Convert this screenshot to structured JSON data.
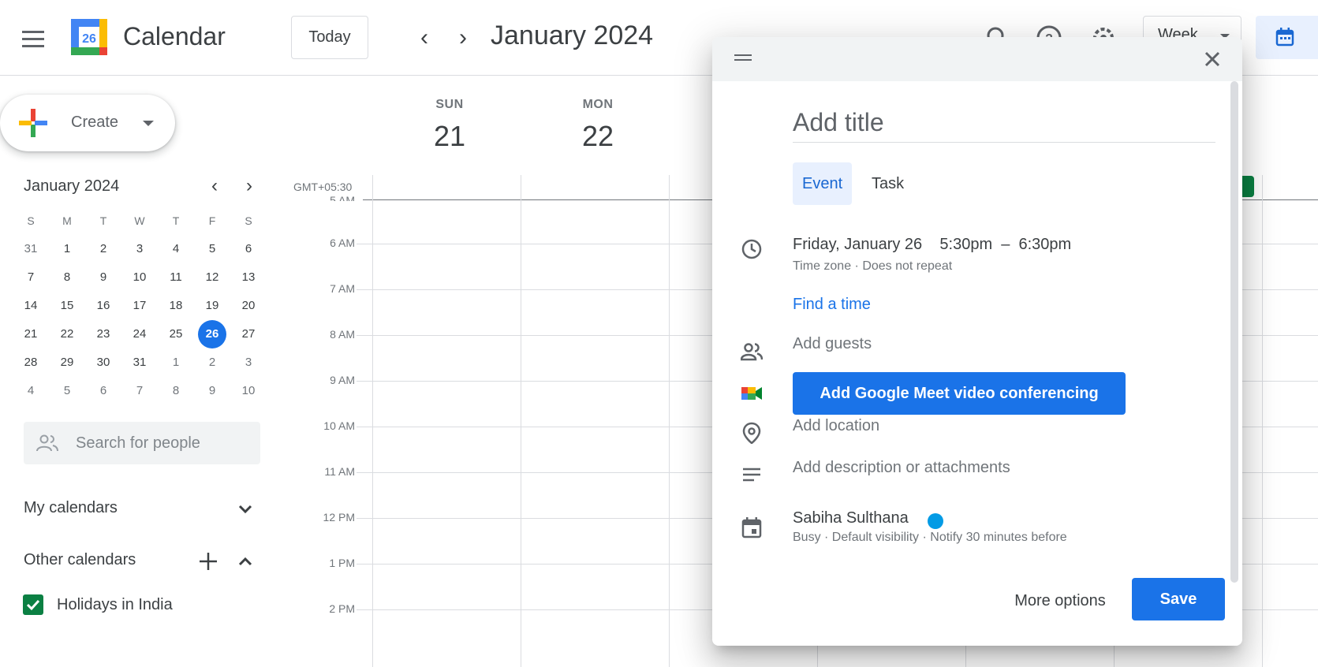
{
  "header": {
    "app_title": "Calendar",
    "logo_number": "26",
    "today_label": "Today",
    "prev_icon": "chevron-left",
    "next_icon": "chevron-right",
    "current_period": "January 2024",
    "view_label": "Week"
  },
  "sidebar": {
    "create_label": "Create",
    "mini_calendar": {
      "title": "January 2024",
      "weekdays": [
        "S",
        "M",
        "T",
        "W",
        "T",
        "F",
        "S"
      ],
      "weeks": [
        [
          "31",
          "1",
          "2",
          "3",
          "4",
          "5",
          "6"
        ],
        [
          "7",
          "8",
          "9",
          "10",
          "11",
          "12",
          "13"
        ],
        [
          "14",
          "15",
          "16",
          "17",
          "18",
          "19",
          "20"
        ],
        [
          "21",
          "22",
          "23",
          "24",
          "25",
          "26",
          "27"
        ],
        [
          "28",
          "29",
          "30",
          "31",
          "1",
          "2",
          "3"
        ],
        [
          "4",
          "5",
          "6",
          "7",
          "8",
          "9",
          "10"
        ]
      ],
      "selected_day": "26"
    },
    "search_placeholder": "Search for people",
    "my_calendars": "My calendars",
    "other_calendars": "Other calendars",
    "calendar_items": [
      {
        "label": "Holidays in India",
        "checked": true,
        "color": "#0b8043"
      }
    ]
  },
  "grid": {
    "timezone": "GMT+05:30",
    "days": [
      {
        "name": "SUN",
        "num": "21"
      },
      {
        "name": "MON",
        "num": "22"
      }
    ],
    "partial_time": "5 AM",
    "times": [
      "6 AM",
      "7 AM",
      "8 AM",
      "9 AM",
      "10 AM",
      "11 AM",
      "12 PM",
      "1 PM",
      "2 PM"
    ]
  },
  "dialog": {
    "title_placeholder": "Add title",
    "tab_event": "Event",
    "tab_task": "Task",
    "date": "Friday, January 26",
    "start_time": "5:30pm",
    "dash": "–",
    "end_time": "6:30pm",
    "timezone_repeat": "Time zone · Does not repeat",
    "find_time": "Find a time",
    "add_guests": "Add guests",
    "meet_button": "Add Google Meet video conferencing",
    "add_location": "Add location",
    "add_description": "Add description or attachments",
    "owner": "Sabiha Sulthana",
    "owner_details": "Busy · Default visibility · Notify 30 minutes before",
    "more_options": "More options",
    "save": "Save"
  },
  "colors": {
    "accent": "#1a73e8",
    "owner_dot": "#039be5",
    "holiday_green": "#0b8043"
  }
}
